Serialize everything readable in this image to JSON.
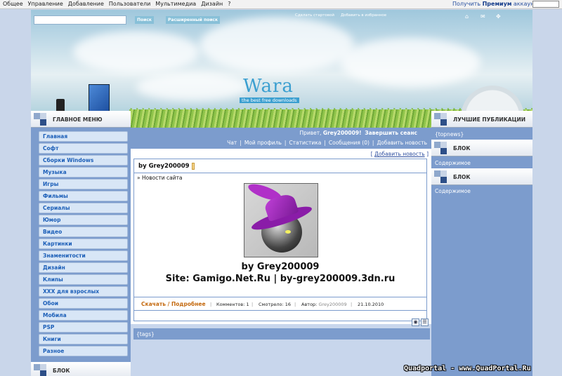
{
  "admin_bar": {
    "menu": [
      "Общее",
      "Управление",
      "Добавление",
      "Пользователи",
      "Мультимедиа",
      "Дизайн",
      "?"
    ],
    "premium_prefix": "Получить",
    "premium_bold": "Премиум",
    "premium_suffix": "аккаунт"
  },
  "header": {
    "search_button": "Поиск",
    "advanced_search_button": "Расширенный поиск",
    "link_homepage": "Сделать стартовой",
    "link_favorites": "Добавить в избранное",
    "logo": "Wara",
    "tagline": "the best free downloads"
  },
  "left_sidebar": {
    "main_menu_title": "ГЛАВНОЕ МЕНЮ",
    "items": [
      {
        "label": "Главная"
      },
      {
        "label": "Софт"
      },
      {
        "label": "Сборки Windows"
      },
      {
        "label": "Музыка"
      },
      {
        "label": "Игры"
      },
      {
        "label": "Фильмы"
      },
      {
        "label": "Сериалы"
      },
      {
        "label": "Юмор"
      },
      {
        "label": "Видео"
      },
      {
        "label": "Картинки"
      },
      {
        "label": "Знаменитости"
      },
      {
        "label": "Дизайн"
      },
      {
        "label": "Клипы"
      },
      {
        "label": "XXX для взрослых"
      },
      {
        "label": "Обои"
      },
      {
        "label": "Мобила"
      },
      {
        "label": "PSP"
      },
      {
        "label": "Книги"
      },
      {
        "label": "Разное"
      }
    ],
    "block_title": "БЛОК"
  },
  "userbar": {
    "greeting_prefix": "Привет,",
    "username": "Grey200009!",
    "logout": "Завершить сеанс",
    "links": [
      "Чат",
      "Мой профиль",
      "Статистика",
      "Сообщения (0)",
      "Добавить новость"
    ]
  },
  "content": {
    "add_news_open": "[",
    "add_news": "Добавить новость",
    "add_news_close": "]",
    "post": {
      "title": "by Grey200009",
      "category_prefix": "»",
      "category": "Новости сайта",
      "line1": "by Grey200009",
      "line2": "Site: Gamigo.Net.Ru | by-grey200009.3dn.ru",
      "download": "Скачать",
      "slash": "/",
      "more": "Подробнее",
      "comments": "Комментов: 1",
      "views": "Смотрело: 16",
      "author_label": "Автор:",
      "author": "Grey200009",
      "date": "21.10.2010",
      "sep": "|"
    },
    "tags": "{tags}"
  },
  "right_sidebar": {
    "top_title": "ЛУЧШИЕ ПУБЛИКАЦИИ",
    "top_content": "{topnews}",
    "block1_title": "БЛОК",
    "block1_content": "Содержимое",
    "block2_title": "БЛОК",
    "block2_content": "Содержимое"
  },
  "watermark": "Quadportal - www.QuadPortal.Ru",
  "colors": {
    "frame": "#7c9ccd",
    "menu_item_bg": "#d8e6f6",
    "menu_item_text": "#1c5fb8",
    "download_link": "#c46a10",
    "logo": "#3b9fd0"
  }
}
